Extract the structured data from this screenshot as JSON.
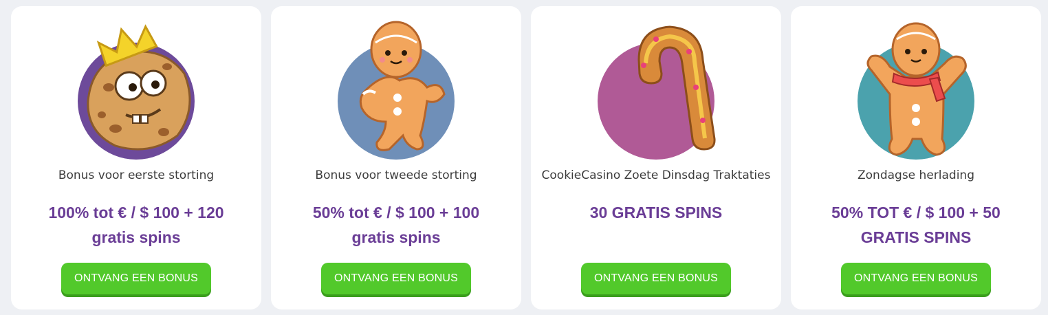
{
  "colors": {
    "page_background": "#eef0f4",
    "card_background": "#ffffff",
    "offer_text": "#6a3d96",
    "button_green": "#52c92b",
    "button_shadow": "#3a9e1c"
  },
  "bonuses": [
    {
      "art": "crowned-cookie-icon",
      "circle_color": "#6d4a9a",
      "title": "Bonus voor eerste storting",
      "offer_line1": "100% tot € / $ 100 + 120",
      "offer_line2": "gratis spins",
      "button_label": "ONTVANG EEN BONUS"
    },
    {
      "art": "gingerbread-man-icon",
      "circle_color": "#6f8fb8",
      "title": "Bonus voor tweede storting",
      "offer_line1": "50% tot € / $ 100 + 100",
      "offer_line2": "gratis spins",
      "button_label": "ONTVANG EEN BONUS"
    },
    {
      "art": "candy-cane-cookie-icon",
      "circle_color": "#b05a96",
      "title": "CookieCasino Zoete Dinsdag Traktaties",
      "offer_line1": "30 GRATIS SPINS",
      "offer_line2": "",
      "button_label": "ONTVANG EEN BONUS"
    },
    {
      "art": "gingerbread-man-scarf-icon",
      "circle_color": "#4ba2ad",
      "title": "Zondagse herlading",
      "offer_line1": "50% TOT € / $ 100 + 50",
      "offer_line2": "GRATIS SPINS",
      "button_label": "ONTVANG EEN BONUS"
    }
  ]
}
